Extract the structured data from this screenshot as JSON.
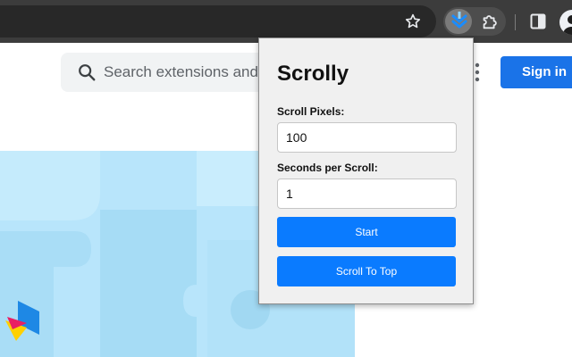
{
  "toolbar": {
    "icons": [
      "bookmark-star-icon",
      "scrolly-extension-icon",
      "extensions-puzzle-icon",
      "side-panel-icon",
      "profile-avatar-icon"
    ]
  },
  "page": {
    "search": {
      "placeholder": "Search extensions and themes"
    },
    "sign_in_label": "Sign in",
    "colors": {
      "accent": "#1a73e8"
    }
  },
  "popup": {
    "title": "Scrolly",
    "scroll_pixels": {
      "label": "Scroll Pixels:",
      "value": "100"
    },
    "seconds_per_scroll": {
      "label": "Seconds per Scroll:",
      "value": "1"
    },
    "start_label": "Start",
    "scroll_top_label": "Scroll To Top",
    "colors": {
      "button": "#0a7bff",
      "background": "#f0f0f0"
    }
  }
}
